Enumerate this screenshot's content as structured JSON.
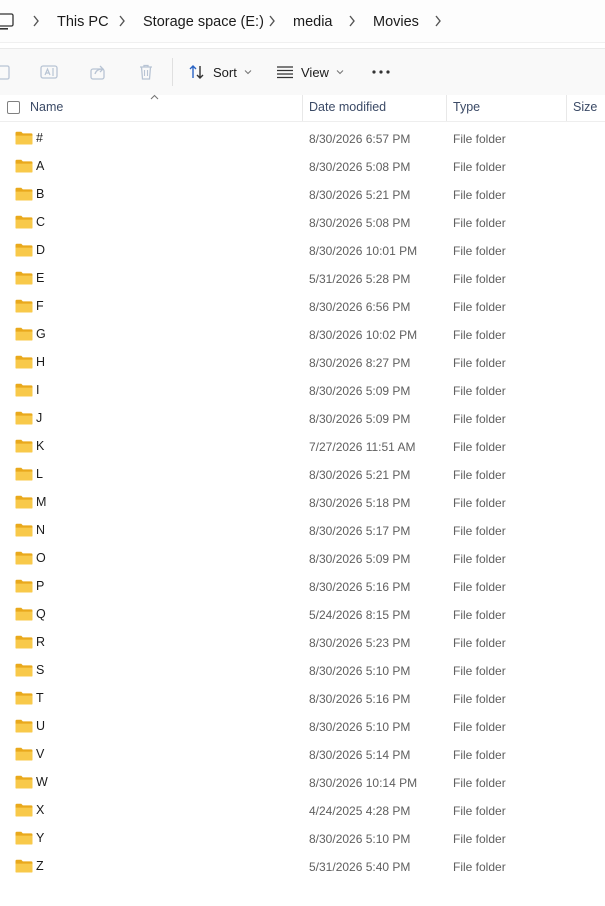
{
  "breadcrumb": {
    "items": [
      "This PC",
      "Storage space (E:)",
      "media",
      "Movies"
    ]
  },
  "toolbar": {
    "sort_label": "Sort",
    "view_label": "View",
    "more_label": "•••"
  },
  "columns": {
    "name": "Name",
    "date": "Date modified",
    "type": "Type",
    "size": "Size"
  },
  "files": [
    {
      "name": "#",
      "date": "8/30/2026 6:57 PM",
      "type": "File folder"
    },
    {
      "name": "A",
      "date": "8/30/2026 5:08 PM",
      "type": "File folder"
    },
    {
      "name": "B",
      "date": "8/30/2026 5:21 PM",
      "type": "File folder"
    },
    {
      "name": "C",
      "date": "8/30/2026 5:08 PM",
      "type": "File folder"
    },
    {
      "name": "D",
      "date": "8/30/2026 10:01 PM",
      "type": "File folder"
    },
    {
      "name": "E",
      "date": "5/31/2026 5:28 PM",
      "type": "File folder"
    },
    {
      "name": "F",
      "date": "8/30/2026 6:56 PM",
      "type": "File folder"
    },
    {
      "name": "G",
      "date": "8/30/2026 10:02 PM",
      "type": "File folder"
    },
    {
      "name": "H",
      "date": "8/30/2026 8:27 PM",
      "type": "File folder"
    },
    {
      "name": "I",
      "date": "8/30/2026 5:09 PM",
      "type": "File folder"
    },
    {
      "name": "J",
      "date": "8/30/2026 5:09 PM",
      "type": "File folder"
    },
    {
      "name": "K",
      "date": "7/27/2026 11:51 AM",
      "type": "File folder"
    },
    {
      "name": "L",
      "date": "8/30/2026 5:21 PM",
      "type": "File folder"
    },
    {
      "name": "M",
      "date": "8/30/2026 5:18 PM",
      "type": "File folder"
    },
    {
      "name": "N",
      "date": "8/30/2026 5:17 PM",
      "type": "File folder"
    },
    {
      "name": "O",
      "date": "8/30/2026 5:09 PM",
      "type": "File folder"
    },
    {
      "name": "P",
      "date": "8/30/2026 5:16 PM",
      "type": "File folder"
    },
    {
      "name": "Q",
      "date": "5/24/2026 8:15 PM",
      "type": "File folder"
    },
    {
      "name": "R",
      "date": "8/30/2026 5:23 PM",
      "type": "File folder"
    },
    {
      "name": "S",
      "date": "8/30/2026 5:10 PM",
      "type": "File folder"
    },
    {
      "name": "T",
      "date": "8/30/2026 5:16 PM",
      "type": "File folder"
    },
    {
      "name": "U",
      "date": "8/30/2026 5:10 PM",
      "type": "File folder"
    },
    {
      "name": "V",
      "date": "8/30/2026 5:14 PM",
      "type": "File folder"
    },
    {
      "name": "W",
      "date": "8/30/2026 10:14 PM",
      "type": "File folder"
    },
    {
      "name": "X",
      "date": "4/24/2025 4:28 PM",
      "type": "File folder"
    },
    {
      "name": "Y",
      "date": "8/30/2026 5:10 PM",
      "type": "File folder"
    },
    {
      "name": "Z",
      "date": "5/31/2026 5:40 PM",
      "type": "File folder"
    }
  ],
  "icons": {
    "folder_color": "#f8c94a",
    "folder_tab_color": "#e9a91c"
  }
}
